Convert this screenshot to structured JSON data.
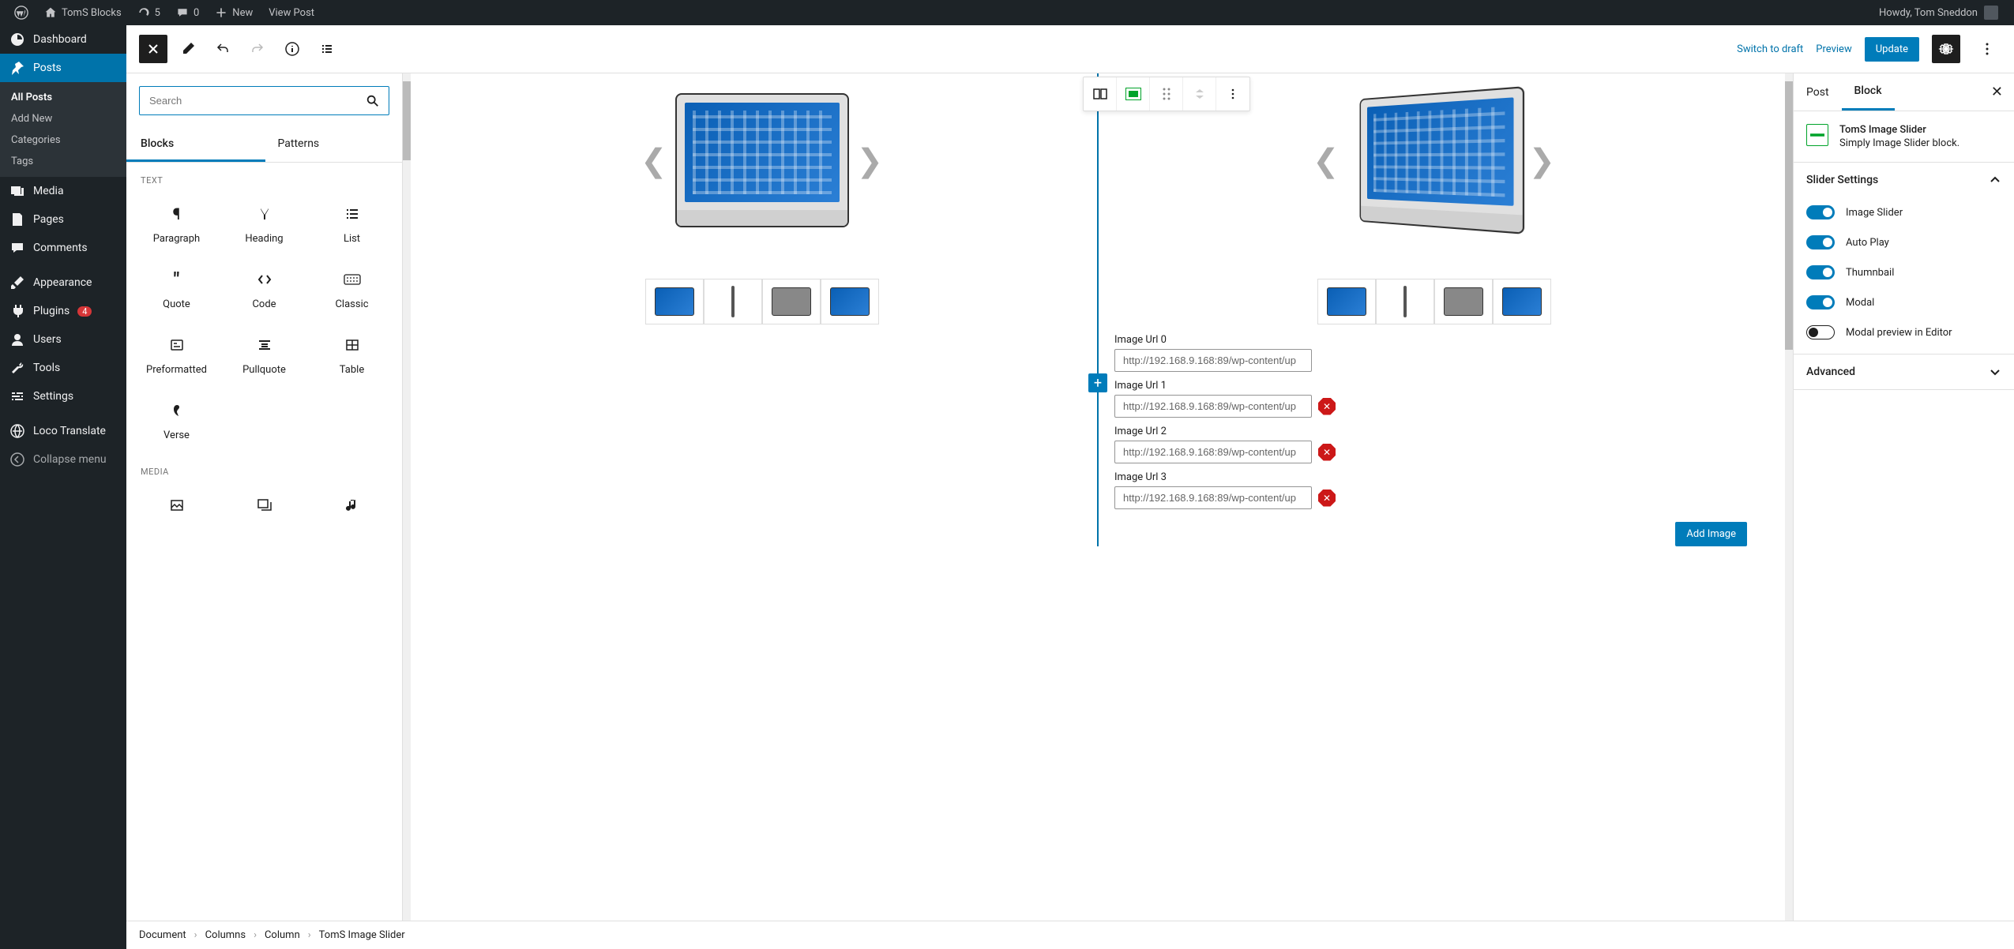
{
  "adminbar": {
    "site_title": "TomS Blocks",
    "updates": "5",
    "comments": "0",
    "new": "New",
    "view_post": "View Post",
    "howdy": "Howdy, Tom Sneddon"
  },
  "sidebar": {
    "dashboard": "Dashboard",
    "posts": "Posts",
    "posts_sub": {
      "all": "All Posts",
      "add_new": "Add New",
      "categories": "Categories",
      "tags": "Tags"
    },
    "media": "Media",
    "pages": "Pages",
    "comments": "Comments",
    "appearance": "Appearance",
    "plugins": "Plugins",
    "plugins_badge": "4",
    "users": "Users",
    "tools": "Tools",
    "settings": "Settings",
    "loco": "Loco Translate",
    "collapse": "Collapse menu"
  },
  "topbar": {
    "switch_draft": "Switch to draft",
    "preview": "Preview",
    "update": "Update"
  },
  "inserter": {
    "search_placeholder": "Search",
    "tab_blocks": "Blocks",
    "tab_patterns": "Patterns",
    "section_text": "TEXT",
    "section_media": "MEDIA",
    "blocks": {
      "paragraph": "Paragraph",
      "heading": "Heading",
      "list": "List",
      "quote": "Quote",
      "code": "Code",
      "classic": "Classic",
      "preformatted": "Preformatted",
      "pullquote": "Pullquote",
      "table": "Table",
      "verse": "Verse"
    }
  },
  "image_urls": {
    "label_0": "Image Url 0",
    "label_1": "Image Url 1",
    "label_2": "Image Url 2",
    "label_3": "Image Url 3",
    "value_0": "http://192.168.9.168:89/wp-content/up",
    "value_1": "http://192.168.9.168:89/wp-content/up",
    "value_2": "http://192.168.9.168:89/wp-content/up",
    "value_3": "http://192.168.9.168:89/wp-content/up",
    "add_button": "Add Image"
  },
  "settings": {
    "tab_post": "Post",
    "tab_block": "Block",
    "block_title": "TomS Image Slider",
    "block_desc": "Simply Image Slider block.",
    "section_slider": "Slider Settings",
    "section_advanced": "Advanced",
    "toggle_image_slider": "Image Slider",
    "toggle_auto_play": "Auto Play",
    "toggle_thumbnail": "Thumnbail",
    "toggle_modal": "Modal",
    "toggle_modal_preview": "Modal preview in Editor"
  },
  "breadcrumb": {
    "document": "Document",
    "columns": "Columns",
    "column": "Column",
    "block": "TomS Image Slider"
  }
}
